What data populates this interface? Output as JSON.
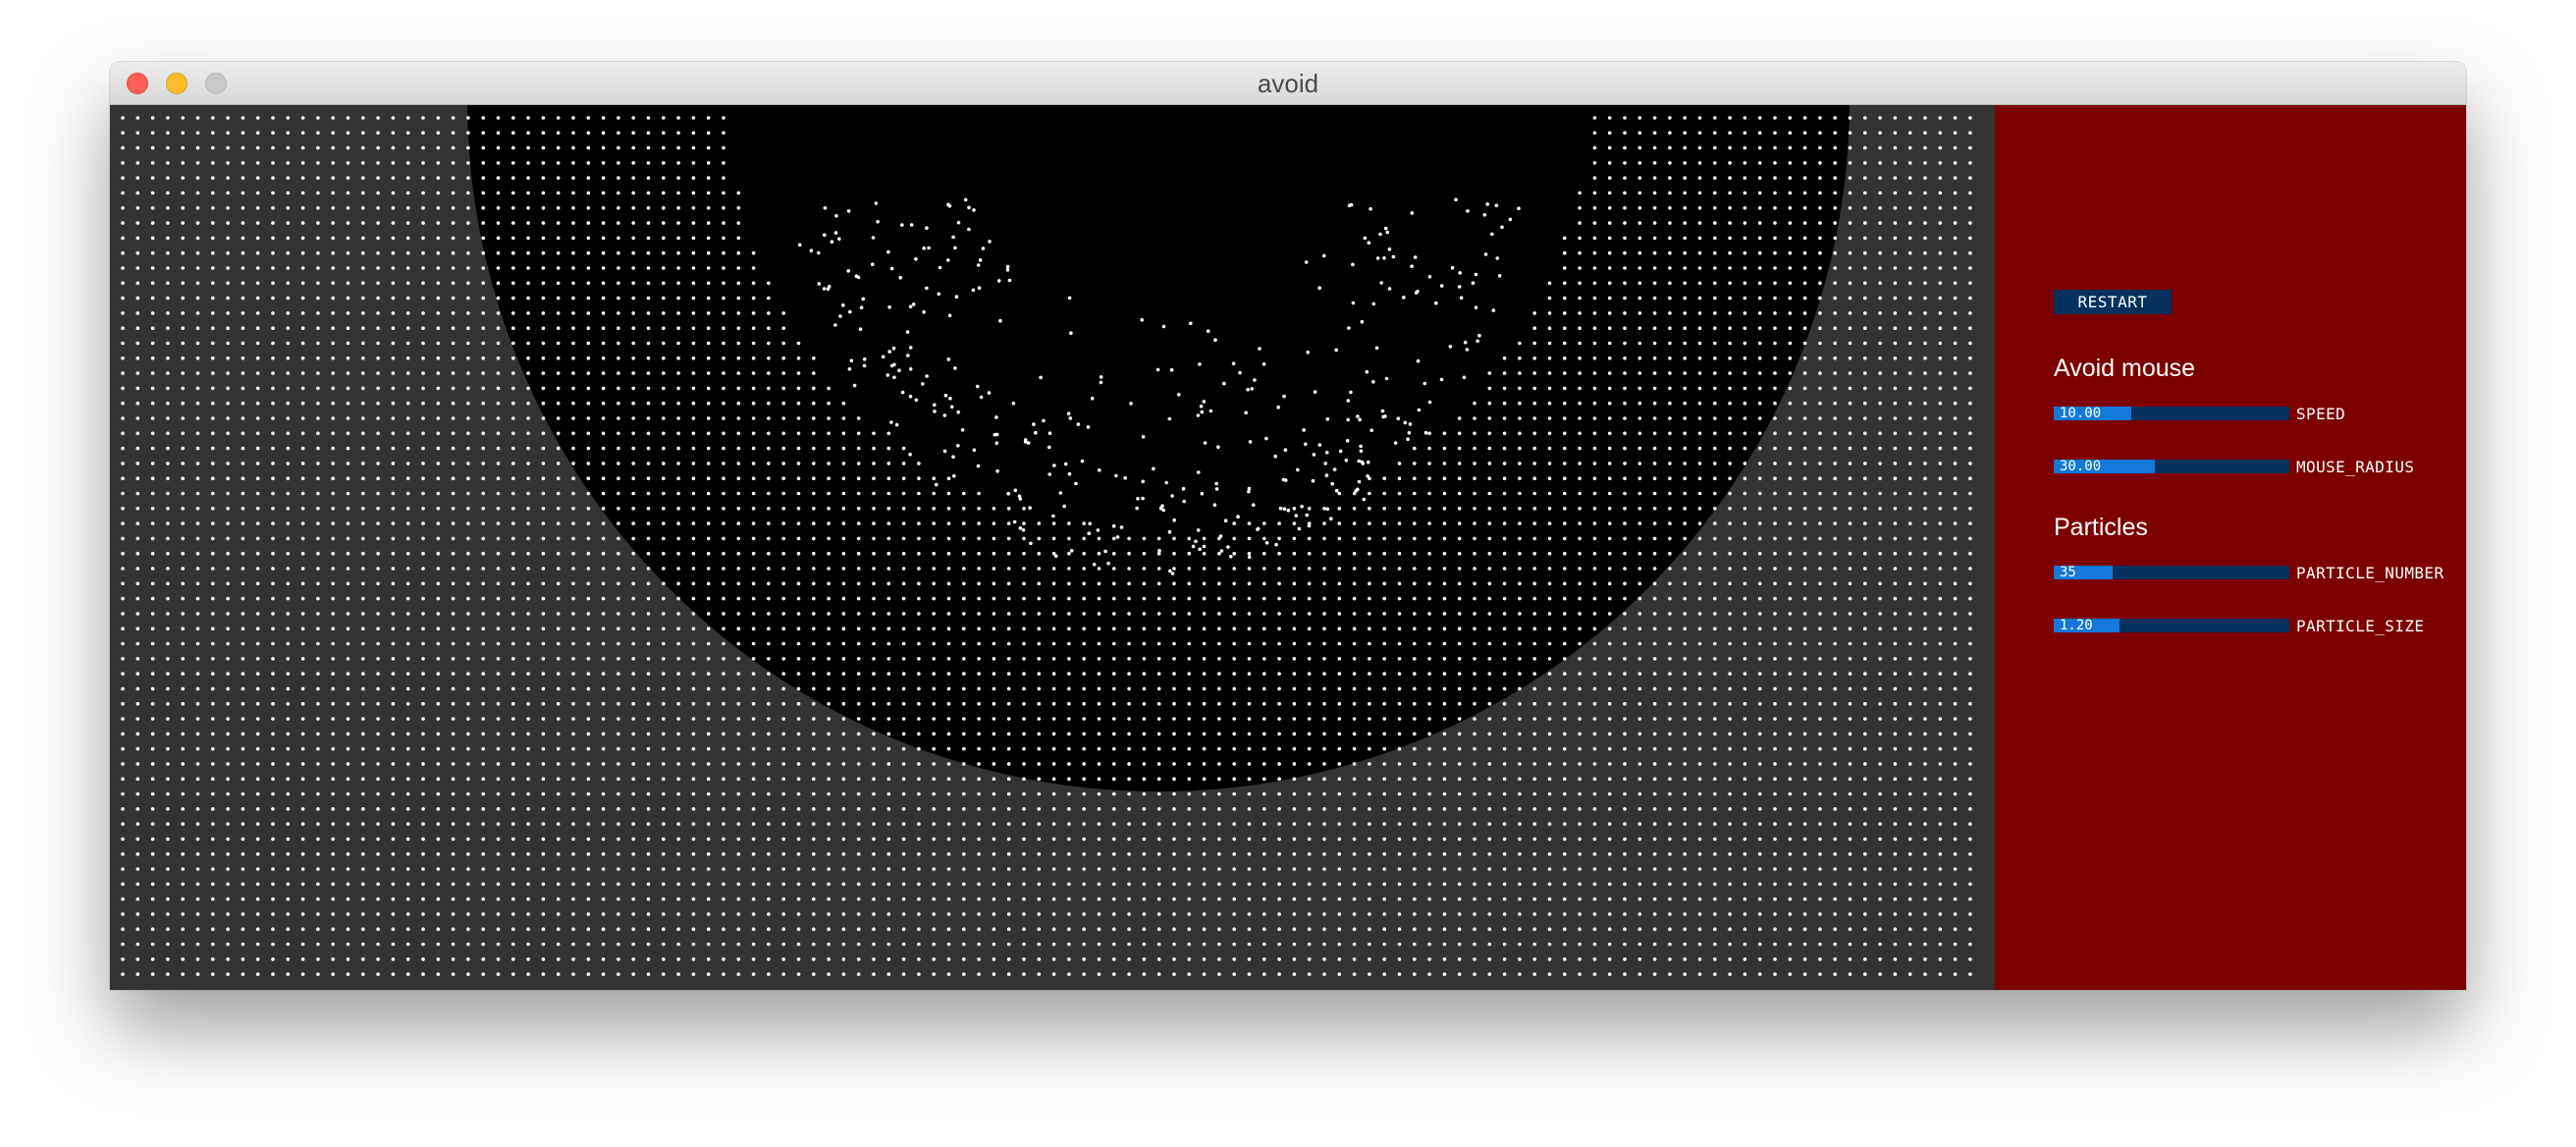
{
  "window": {
    "title": "avoid"
  },
  "controls": {
    "restart_label": "RESTART",
    "groups": [
      {
        "label": "Avoid mouse",
        "sliders": [
          {
            "name": "SPEED",
            "value_text": "10.00",
            "fraction": 0.33
          },
          {
            "name": "MOUSE_RADIUS",
            "value_text": "30.00",
            "fraction": 0.43
          }
        ]
      },
      {
        "label": "Particles",
        "sliders": [
          {
            "name": "PARTICLE_NUMBER",
            "value_text": "35",
            "fraction": 0.25
          },
          {
            "name": "PARTICLE_SIZE",
            "value_text": "1.20",
            "fraction": 0.28
          }
        ]
      }
    ]
  },
  "colors": {
    "canvas_background": "#333333",
    "avoid_region": "#000000",
    "particle": "#ffffff",
    "panel_background": "#7c0000",
    "slider_track": "#06305e",
    "slider_fill": "#1478da"
  }
}
